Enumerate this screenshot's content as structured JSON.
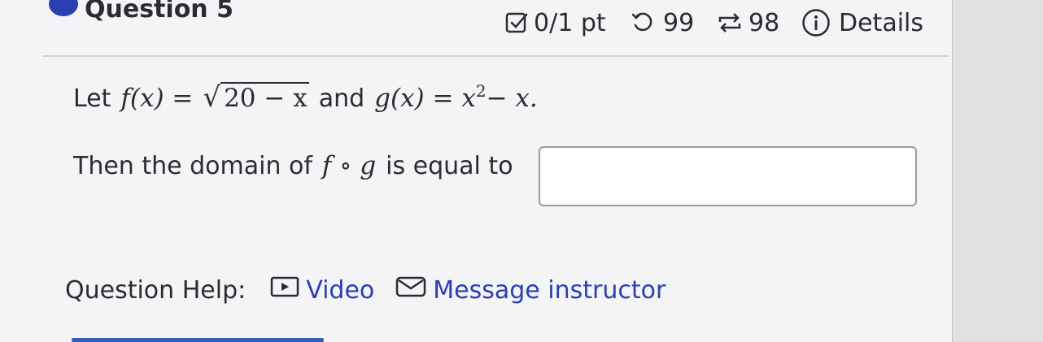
{
  "question": {
    "title": "Question 5",
    "score": "0/1 pt",
    "tries_left": "99",
    "submissions_left": "98",
    "details_label": "Details",
    "icons": {
      "status": "circle-dot-icon",
      "score": "checkbox-icon",
      "tries": "retry-icon",
      "submissions": "repeat-icon",
      "details": "info-icon"
    }
  },
  "problem": {
    "let_text": "Let",
    "f_lhs": "f(x) =",
    "radicand": "20 − x",
    "and_text": "and",
    "g_lhs": "g(x) = x",
    "g_exp": "2",
    "g_rest": " − x.",
    "then_text": "Then the domain of",
    "composition": "f ∘ g",
    "is_equal_text": "is equal to",
    "answer_value": ""
  },
  "help": {
    "label": "Question Help:",
    "video_label": "Video",
    "message_label": "Message instructor"
  },
  "colors": {
    "accent": "#2b3fb0",
    "link": "#2b3fb0",
    "card_bg": "#f4f3f6"
  }
}
